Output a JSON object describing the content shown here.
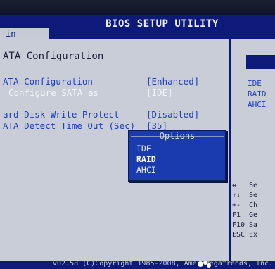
{
  "title": "BIOS SETUP UTILITY",
  "menu": {
    "label": "in"
  },
  "panel_title": "ATA Configuration",
  "options": [
    {
      "label": "ATA Configuration",
      "value": "[Enhanced]"
    },
    {
      "label": "Configure SATA as",
      "value": "[IDE]"
    },
    {
      "label": "ard Disk Write Protect",
      "value": "[Disabled]"
    },
    {
      "label": "ATA Detect Time Out (Sec)",
      "value": "[35]"
    }
  ],
  "help": {
    "lines": [
      "IDE",
      "RAID",
      "AHCI"
    ]
  },
  "keys": [
    {
      "key": "↔",
      "desc": "Se"
    },
    {
      "key": "↑↓",
      "desc": "Se"
    },
    {
      "key": "+-",
      "desc": "Ch"
    },
    {
      "key": "F1",
      "desc": "Ge"
    },
    {
      "key": "F10",
      "desc": "Sa"
    },
    {
      "key": "ESC",
      "desc": "Ex"
    }
  ],
  "popup": {
    "title": "Options",
    "items": [
      "IDE",
      "RAID",
      "AHCI"
    ],
    "selected": "RAID"
  },
  "footer": {
    "copyright": "v02.58 (C)Copyright 1985-2008, Amer    Megatrends, Inc."
  },
  "colors": {
    "accent": "#0d1a7a",
    "panel": "#c9cdd8",
    "option_text": "#1e3fb8"
  }
}
